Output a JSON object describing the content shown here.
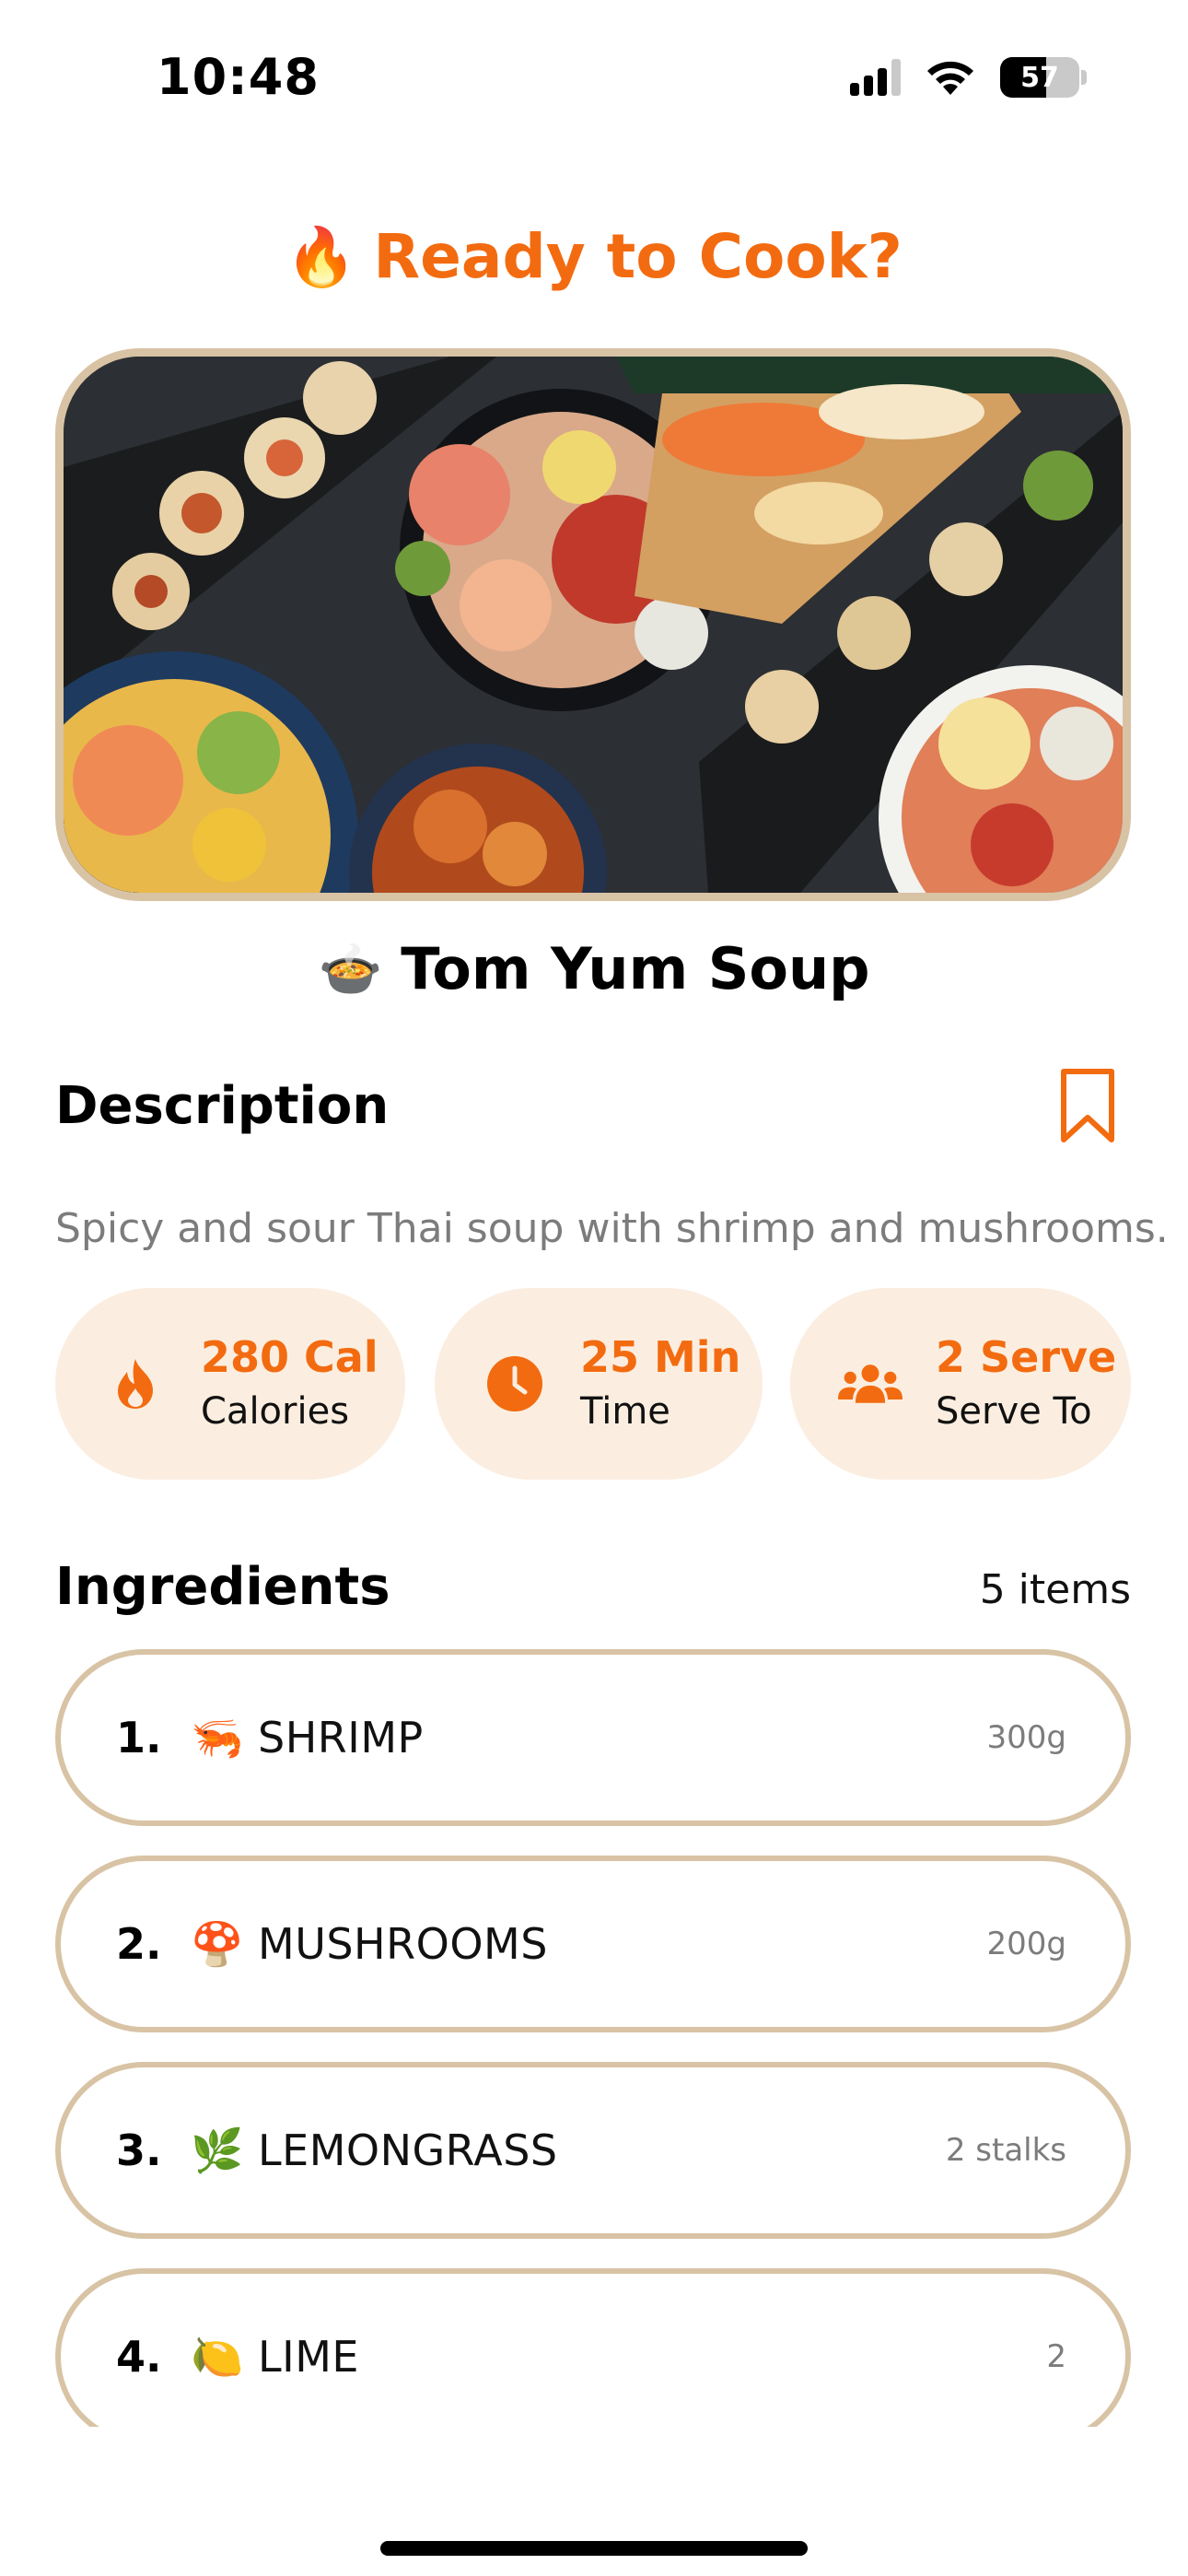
{
  "status_bar": {
    "time": "10:48",
    "battery": "57"
  },
  "header": {
    "icon": "🔥",
    "title": "Ready to Cook?"
  },
  "dish": {
    "emoji": "🍲",
    "name": "Tom Yum Soup"
  },
  "description": {
    "heading": "Description",
    "text": "Spicy and sour Thai soup with shrimp and mushrooms."
  },
  "stats": [
    {
      "icon": "flame-icon",
      "value": "280 Cal",
      "label": "Calories"
    },
    {
      "icon": "clock-icon",
      "value": "25 Min",
      "label": "Time"
    },
    {
      "icon": "people-icon",
      "value": "2 Serve",
      "label": "Serve To"
    }
  ],
  "ingredients": {
    "heading": "Ingredients",
    "count": "5 items",
    "items": [
      {
        "num": "1.",
        "emoji": "🦐",
        "name": "SHRIMP",
        "qty": "300g"
      },
      {
        "num": "2.",
        "emoji": "🍄",
        "name": "MUSHROOMS",
        "qty": "200g"
      },
      {
        "num": "3.",
        "emoji": "🌿",
        "name": "LEMONGRASS",
        "qty": "2 stalks"
      },
      {
        "num": "4.",
        "emoji": "🍋",
        "name": "LIME",
        "qty": "2"
      }
    ]
  },
  "colors": {
    "accent": "#f36b10",
    "pill_bg": "#fbeee0",
    "border": "#d8c3a5"
  }
}
